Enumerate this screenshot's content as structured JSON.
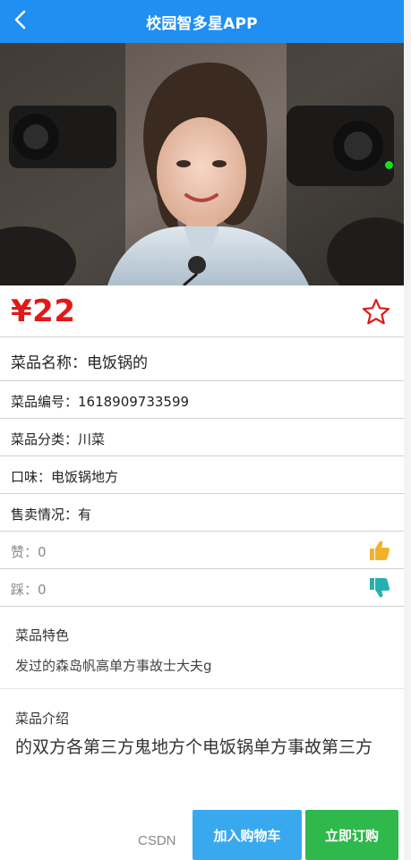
{
  "header": {
    "title": "校园智多星APP"
  },
  "item": {
    "price": "¥22",
    "name": "菜品名称：电饭锅的",
    "code": "菜品编号：1618909733599",
    "category": "菜品分类：川菜",
    "taste": "口味：电饭锅地方",
    "sale_status": "售卖情况：有",
    "likes": "赞：0",
    "dislikes": "踩：0"
  },
  "sections": {
    "feature_title": "菜品特色",
    "feature_text": "发过的森岛帆高单方事故士大夫g",
    "intro_title": "菜品介绍",
    "intro_text": "的双方各第三方鬼地方个电饭锅单方事故第三方"
  },
  "footer": {
    "left_button": "加入购物车",
    "right_button": "立即订购",
    "watermark": "CSDN"
  },
  "colors": {
    "header_bg": "#1f8ff2",
    "price": "#e01919",
    "thumb_up": "#f2b12a",
    "thumb_down": "#25b1b0",
    "left_btn": "#39a9ef",
    "right_btn": "#2fb84c"
  }
}
